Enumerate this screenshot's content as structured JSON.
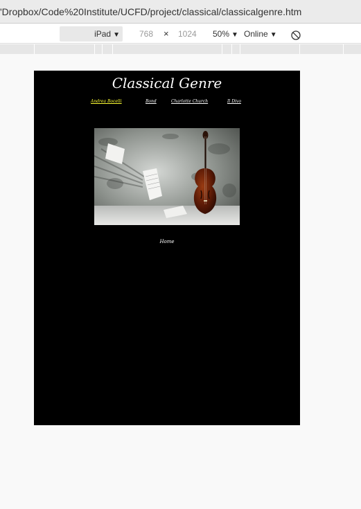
{
  "browser": {
    "url": "'Dropbox/Code%20Institute/UCFD/project/classical/classicalgenre.htm"
  },
  "devtools": {
    "device": "iPad",
    "width": "768",
    "times": "×",
    "height": "1024",
    "zoom": "50%",
    "network": "Online"
  },
  "site": {
    "title": "Classical Genre",
    "nav": [
      "Andrea Bocelli",
      "Bond",
      "Charlotte Church",
      "Il Divo"
    ],
    "footer_link": "Home"
  },
  "icons": {
    "rotate": "rotate-icon",
    "caret": "caret-down-icon"
  }
}
